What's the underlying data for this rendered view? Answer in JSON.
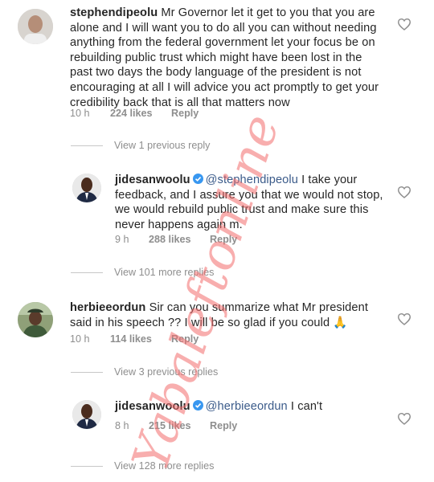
{
  "comments": [
    {
      "username": "stephendipeolu",
      "text": "Mr Governor let it get to you that you are alone and I will want you to do all you can without needing anything from the federal government let your focus be on rebuilding public trust which might have been lost in the past two days the body language of the president is not encouraging at all I will advice you act promptly to get your credibility back that is all that matters now",
      "time": "10 h",
      "likes": "224 likes",
      "reply": "Reply"
    },
    {
      "view_replies": "View 1 previous reply"
    },
    {
      "username": "jidesanwoolu",
      "verified": true,
      "mention": "@stephendipeolu",
      "text": "I take your feedback, and I assure you that we would not stop, we would rebuild public trust and make sure this never happens again m.",
      "time": "9 h",
      "likes": "288 likes",
      "reply": "Reply"
    },
    {
      "view_replies": "View 101 more replies"
    },
    {
      "username": "herbieeordun",
      "text": "Sir can you summarize what Mr president said in his speech ?? I will be so glad if you could 🙏",
      "time": "10 h",
      "likes": "114 likes",
      "reply": "Reply"
    },
    {
      "view_replies": "View 3 previous replies"
    },
    {
      "username": "jidesanwoolu",
      "verified": true,
      "mention": "@herbieeordun",
      "text": "I can't",
      "time": "8 h",
      "likes": "215 likes",
      "reply": "Reply"
    },
    {
      "view_replies": "View 128 more replies"
    }
  ],
  "watermark": "Yabaleftonline",
  "colors": {
    "text": "#262626",
    "meta": "#8e8e8e",
    "mention": "#3b5b8a",
    "verified": "#3897f0",
    "watermark": "#f26b6b"
  }
}
